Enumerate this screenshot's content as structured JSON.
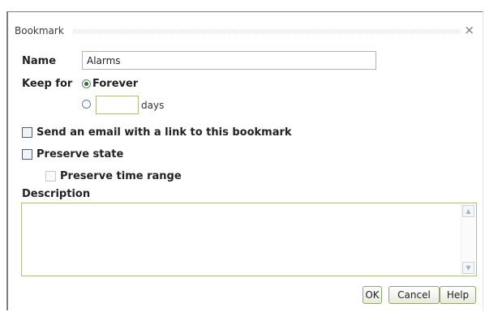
{
  "dialog": {
    "title": "Bookmark",
    "close_glyph": "×"
  },
  "form": {
    "name_label": "Name",
    "name_value": "Alarms",
    "keep_for_label": "Keep for",
    "forever_label": "Forever",
    "forever_selected": true,
    "days_value": "",
    "days_label": "days",
    "email_label": "Send an email with a link to this bookmark",
    "email_checked": false,
    "preserve_state_label": "Preserve state",
    "preserve_state_checked": false,
    "preserve_time_label": "Preserve time range",
    "preserve_time_checked": false,
    "description_label": "Description",
    "description_value": ""
  },
  "buttons": {
    "ok": "OK",
    "cancel": "Cancel",
    "help": "Help"
  }
}
